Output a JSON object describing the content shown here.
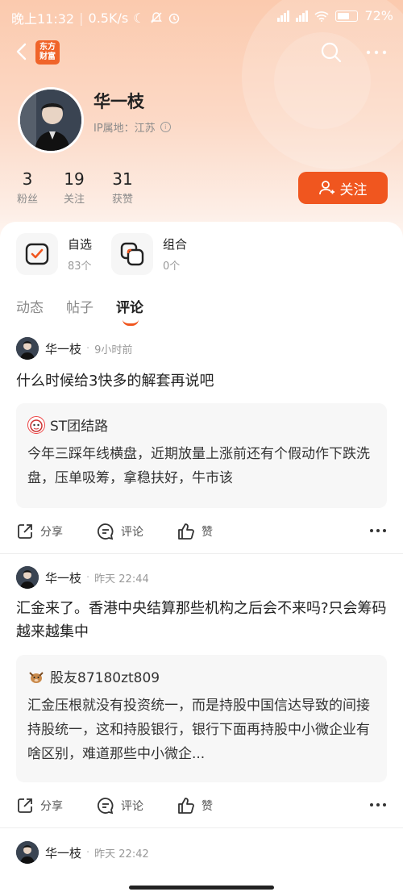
{
  "status_bar": {
    "time": "晚上11:32",
    "speed": "0.5K/s",
    "battery": "72%",
    "battery_level": 0.72
  },
  "nav": {
    "logo_line1": "东方",
    "logo_line2": "财富",
    "icons": [
      "back-arrow-icon",
      "search-icon",
      "more-icon"
    ]
  },
  "profile": {
    "name": "华一枝",
    "ip_location": "IP属地：江苏",
    "stats": [
      {
        "num": "3",
        "label": "粉丝"
      },
      {
        "num": "19",
        "label": "关注"
      },
      {
        "num": "31",
        "label": "获赞"
      }
    ],
    "follow_label": "关注"
  },
  "shortcuts": [
    {
      "title": "自选",
      "count": "83个"
    },
    {
      "title": "组合",
      "count": "0个"
    }
  ],
  "tabs": [
    {
      "label": "动态",
      "active": false
    },
    {
      "label": "帖子",
      "active": false
    },
    {
      "label": "评论",
      "active": true
    }
  ],
  "posts": [
    {
      "author": "华一枝",
      "time": "9小时前",
      "body": "什么时候给3快多的解套再说吧",
      "quote": {
        "author": "ST团结路",
        "body": "今年三踩年线横盘，近期放量上涨前还有个假动作下跌洗盘，压单吸筹，拿稳扶好，牛市该"
      },
      "actions": {
        "share": "分享",
        "comment": "评论",
        "like": "赞"
      }
    },
    {
      "author": "华一枝",
      "time": "昨天 22:44",
      "body": "汇金来了。香港中央结算那些机构之后会不来吗?只会筹码越来越集中",
      "quote": {
        "author": "股友87180zt809",
        "body": "汇金压根就没有投资统一，而是持股中国信达导致的间接持股统一，这和持股银行，银行下面再持股中小微企业有啥区别，难道那些中小微企..."
      },
      "actions": {
        "share": "分享",
        "comment": "评论",
        "like": "赞"
      }
    },
    {
      "author": "华一枝",
      "time": "昨天 22:42"
    }
  ],
  "colors": {
    "accent": "#f0561f",
    "header_gradient_top": "#fbcaae"
  }
}
